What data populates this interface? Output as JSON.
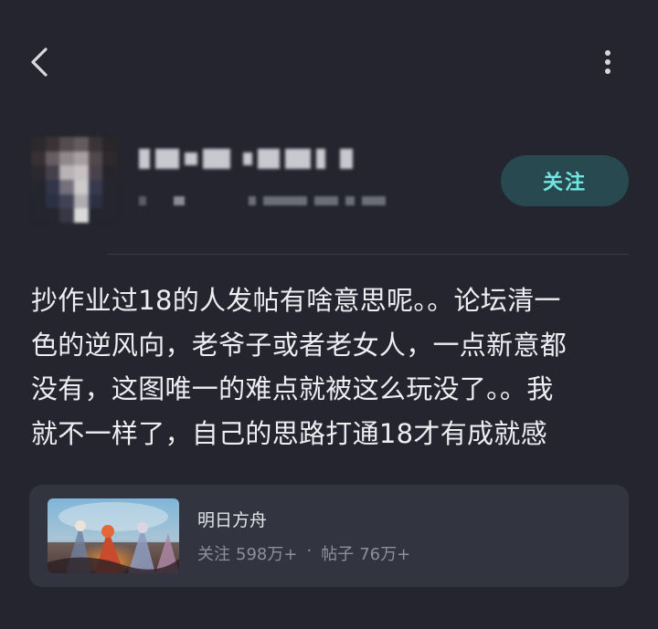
{
  "header": {
    "back_icon": "chevron-left-icon",
    "more_icon": "more-vertical-icon"
  },
  "author": {
    "follow_label": "关注"
  },
  "post": {
    "lines": [
      "抄作业过18的人发帖有啥意思呢。。论坛清一",
      "色的逆风向，老爷子或者老女人，一点新意都",
      "没有，这图唯一的难点就被这么玩没了。。我",
      "就不一样了，自己的思路打通18才有成就感"
    ]
  },
  "topic": {
    "name": "明日方舟",
    "followers_label": "关注",
    "followers_value": "598万+",
    "separator": "·",
    "posts_label": "帖子",
    "posts_value": "76万+"
  },
  "colors": {
    "background": "#24252f",
    "card": "#32343f",
    "follow_bg": "#284950",
    "follow_text": "#6ee7e0"
  }
}
